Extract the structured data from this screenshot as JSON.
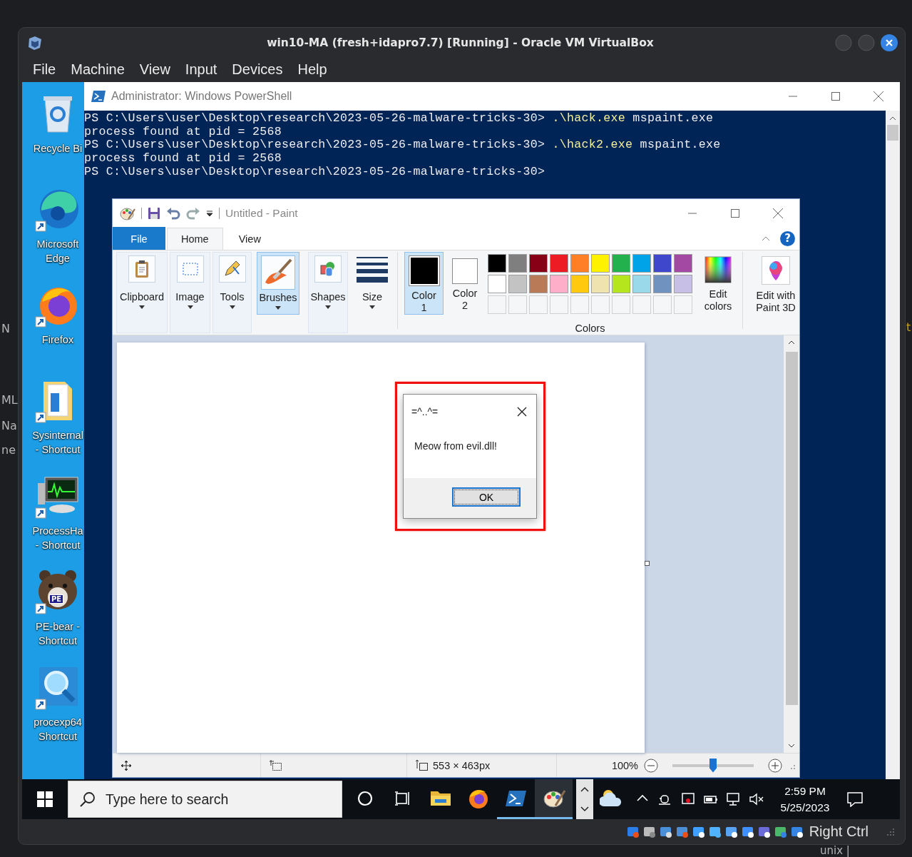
{
  "background_window": {
    "left_fragments": [
      "N",
      "ML",
      "Na",
      "ne"
    ],
    "right_fragment": "t",
    "bottom_fragment": "unix |"
  },
  "vbox": {
    "title": "win10-MA (fresh+idapro7.7) [Running] - Oracle VM VirtualBox",
    "menu": [
      "File",
      "Machine",
      "View",
      "Input",
      "Devices",
      "Help"
    ],
    "host_key": "Right Ctrl"
  },
  "desktop_icons": [
    {
      "kind": "recycle-bin",
      "label": "Recycle Bi",
      "shortcut": false
    },
    {
      "kind": "edge",
      "label": "Microsoft\nEdge",
      "shortcut": true
    },
    {
      "kind": "firefox",
      "label": "Firefox",
      "shortcut": true
    },
    {
      "kind": "folder",
      "label": "Sysinternal\n- Shortcut",
      "shortcut": true
    },
    {
      "kind": "monitor",
      "label": "ProcessHa\n- Shortcut",
      "shortcut": true
    },
    {
      "kind": "bear",
      "badge": "PE",
      "label": "PE-bear -\nShortcut",
      "shortcut": true
    },
    {
      "kind": "magnifier",
      "label": "procexp64\nShortcut",
      "shortcut": true
    }
  ],
  "powershell": {
    "title": "Administrator: Windows PowerShell",
    "lines": [
      {
        "kind": "command",
        "prompt": "PS C:\\Users\\user\\Desktop\\research\\2023-05-26-malware-tricks-30>",
        "command": ".\\hack.exe",
        "args": "mspaint.exe"
      },
      {
        "kind": "output",
        "text": "process found at pid = 2568"
      },
      {
        "kind": "command",
        "prompt": "PS C:\\Users\\user\\Desktop\\research\\2023-05-26-malware-tricks-30>",
        "command": ".\\hack2.exe",
        "args": "mspaint.exe"
      },
      {
        "kind": "output",
        "text": "process found at pid = 2568"
      },
      {
        "kind": "prompt",
        "prompt": "PS C:\\Users\\user\\Desktop\\research\\2023-05-26-malware-tricks-30>"
      }
    ]
  },
  "paint": {
    "title": "Untitled - Paint",
    "help": "?",
    "tabs": [
      {
        "kind": "file",
        "label": "File",
        "selected": false
      },
      {
        "kind": "tab",
        "label": "Home",
        "selected": true
      },
      {
        "kind": "tab",
        "label": "View",
        "selected": false
      }
    ],
    "ribbon": [
      {
        "kind": "clipboard",
        "label": "Clipboard",
        "selected": false
      },
      {
        "kind": "image",
        "label": "Image",
        "selected": false
      },
      {
        "kind": "tools",
        "label": "Tools",
        "selected": false
      },
      {
        "kind": "brushes",
        "label": "Brushes",
        "selected": true
      },
      {
        "kind": "shapes",
        "label": "Shapes",
        "selected": false
      },
      {
        "kind": "size",
        "label": "Size",
        "selected": false
      }
    ],
    "color_slots": [
      {
        "label": "Color\n1",
        "color": "#000000",
        "selected": true
      },
      {
        "label": "Color\n2",
        "color": "#ffffff",
        "selected": false
      }
    ],
    "palette": [
      {
        "color": "#000000"
      },
      {
        "color": "#7f7f7f"
      },
      {
        "color": "#880015"
      },
      {
        "color": "#ed1c24"
      },
      {
        "color": "#ff7f27"
      },
      {
        "color": "#fff200"
      },
      {
        "color": "#22b14c"
      },
      {
        "color": "#00a2e8"
      },
      {
        "color": "#3f48cc"
      },
      {
        "color": "#a349a4"
      },
      {
        "color": "#ffffff"
      },
      {
        "color": "#c3c3c3"
      },
      {
        "color": "#b97a57"
      },
      {
        "color": "#ffaec9"
      },
      {
        "color": "#ffc90e"
      },
      {
        "color": "#efe4b0"
      },
      {
        "color": "#b5e61d"
      },
      {
        "color": "#99d9ea"
      },
      {
        "color": "#7092be"
      },
      {
        "color": "#c8bfe7"
      }
    ],
    "palette_label": "Colors",
    "edit_colors": "Edit\ncolors",
    "paint3d": "Edit with\nPaint 3D",
    "status": {
      "size": "553 × 463px",
      "zoom": "100%",
      "zoom_slider": {
        "level": 0.5
      }
    }
  },
  "dialog": {
    "title": "=^..^=",
    "message": "Meow from evil.dll!",
    "button": "OK",
    "highlighted": true
  },
  "taskbar": {
    "search_placeholder": "Type here to search",
    "apps": [
      {
        "kind": "explorer",
        "running": false,
        "selected": false
      },
      {
        "kind": "firefox",
        "running": false,
        "selected": false
      },
      {
        "kind": "powershell",
        "running": true,
        "selected": false
      },
      {
        "kind": "paint",
        "running": true,
        "selected": true
      }
    ],
    "time": "2:59 PM",
    "date": "5/25/2023"
  }
}
